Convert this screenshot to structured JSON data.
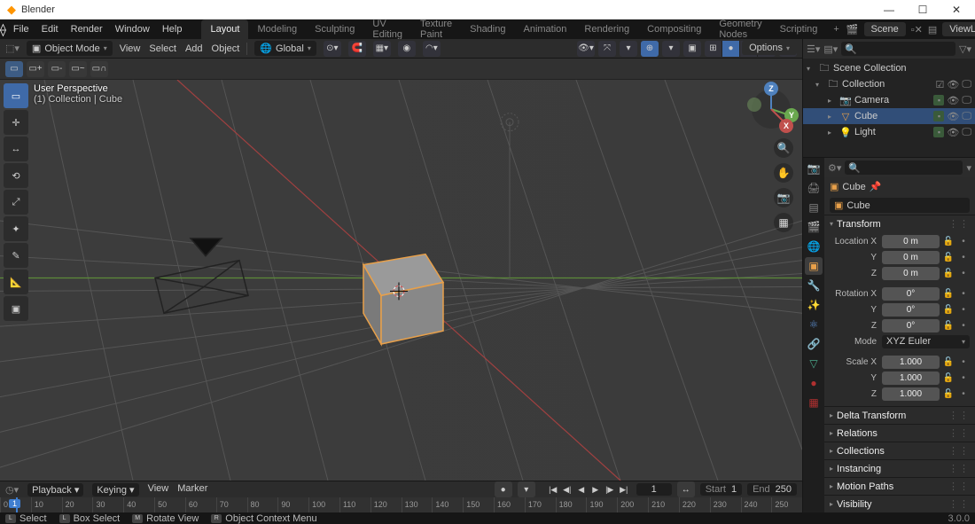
{
  "app": {
    "title": "Blender",
    "version": "3.0.0"
  },
  "win_controls": {
    "minimize": "—",
    "maximize": "☐",
    "close": "✕"
  },
  "top_menus": [
    "File",
    "Edit",
    "Render",
    "Window",
    "Help"
  ],
  "workspace_tabs": [
    "Layout",
    "Modeling",
    "Sculpting",
    "UV Editing",
    "Texture Paint",
    "Shading",
    "Animation",
    "Rendering",
    "Compositing",
    "Geometry Nodes",
    "Scripting"
  ],
  "active_workspace": "Layout",
  "scene": {
    "label": "Scene",
    "viewlayer": "ViewLayer"
  },
  "viewport": {
    "mode": "Object Mode",
    "header_menus": [
      "View",
      "Select",
      "Add",
      "Object"
    ],
    "orientation": "Global",
    "overlay_line1": "User Perspective",
    "overlay_line2": "(1) Collection | Cube",
    "options_label": "Options"
  },
  "tools": [
    {
      "name": "select-box",
      "glyph": "▭",
      "active": true
    },
    {
      "name": "cursor",
      "glyph": "✛",
      "active": false
    },
    {
      "name": "move",
      "glyph": "↔",
      "active": false
    },
    {
      "name": "rotate",
      "glyph": "⟲",
      "active": false
    },
    {
      "name": "scale",
      "glyph": "⤢",
      "active": false
    },
    {
      "name": "transform",
      "glyph": "✦",
      "active": false
    },
    {
      "name": "annotate",
      "glyph": "✎",
      "active": false
    },
    {
      "name": "measure",
      "glyph": "📐",
      "active": false
    },
    {
      "name": "add-cube",
      "glyph": "▣",
      "active": false
    }
  ],
  "gizmo": {
    "x": "X",
    "y": "Y",
    "z": "Z"
  },
  "side_nav": [
    {
      "name": "zoom",
      "glyph": "🔍"
    },
    {
      "name": "pan",
      "glyph": "✋"
    },
    {
      "name": "camera-view",
      "glyph": "📷"
    },
    {
      "name": "perspective",
      "glyph": "▦"
    }
  ],
  "outliner": {
    "root": "Scene Collection",
    "collection": "Collection",
    "items": [
      {
        "name": "Camera",
        "icon": "📷",
        "color": "#7aa87a",
        "selected": false
      },
      {
        "name": "Cube",
        "icon": "▽",
        "color": "#e8a04a",
        "selected": true
      },
      {
        "name": "Light",
        "icon": "💡",
        "color": "#e8a04a",
        "selected": false
      }
    ]
  },
  "properties": {
    "active_object": "Cube",
    "datablock": "Cube",
    "sections": {
      "transform": {
        "title": "Transform",
        "location": {
          "label": "Location X",
          "x": "0 m",
          "y": "0 m",
          "z": "0 m"
        },
        "rotation": {
          "label": "Rotation X",
          "x": "0°",
          "y": "0°",
          "z": "0°"
        },
        "mode": {
          "label": "Mode",
          "value": "XYZ Euler"
        },
        "scale": {
          "label": "Scale X",
          "x": "1.000",
          "y": "1.000",
          "z": "1.000"
        }
      },
      "collapsed": [
        "Delta Transform",
        "Relations",
        "Collections",
        "Instancing",
        "Motion Paths",
        "Visibility"
      ]
    },
    "tabs": [
      {
        "name": "render",
        "glyph": "📷",
        "color": "#888"
      },
      {
        "name": "output",
        "glyph": "🖨",
        "color": "#888"
      },
      {
        "name": "view-layer",
        "glyph": "▤",
        "color": "#888"
      },
      {
        "name": "scene",
        "glyph": "🎬",
        "color": "#888"
      },
      {
        "name": "world",
        "glyph": "🌐",
        "color": "#b03030"
      },
      {
        "name": "object",
        "glyph": "▣",
        "color": "#e8a04a",
        "active": true
      },
      {
        "name": "modifiers",
        "glyph": "🔧",
        "color": "#5a8ac8"
      },
      {
        "name": "particles",
        "glyph": "✨",
        "color": "#5a8ac8"
      },
      {
        "name": "physics",
        "glyph": "⚛",
        "color": "#5a8ac8"
      },
      {
        "name": "constraints",
        "glyph": "🔗",
        "color": "#5a8ac8"
      },
      {
        "name": "data",
        "glyph": "▽",
        "color": "#4aa88a"
      },
      {
        "name": "material",
        "glyph": "●",
        "color": "#b03030"
      },
      {
        "name": "texture",
        "glyph": "▦",
        "color": "#b03030"
      }
    ]
  },
  "timeline": {
    "menus": [
      "Playback",
      "Keying",
      "View",
      "Marker"
    ],
    "current": 1,
    "start_label": "Start",
    "start": 1,
    "end_label": "End",
    "end": 250,
    "ticks": [
      0,
      10,
      20,
      30,
      40,
      50,
      60,
      70,
      80,
      90,
      100,
      110,
      120,
      130,
      140,
      150,
      160,
      170,
      180,
      190,
      200,
      210,
      220,
      230,
      240,
      250
    ]
  },
  "statusbar": {
    "items": [
      {
        "icon": "L",
        "label": "Select"
      },
      {
        "icon": "L",
        "label": "Box Select"
      },
      {
        "icon": "M",
        "label": "Rotate View"
      },
      {
        "icon": "R",
        "label": "Object Context Menu"
      }
    ]
  }
}
